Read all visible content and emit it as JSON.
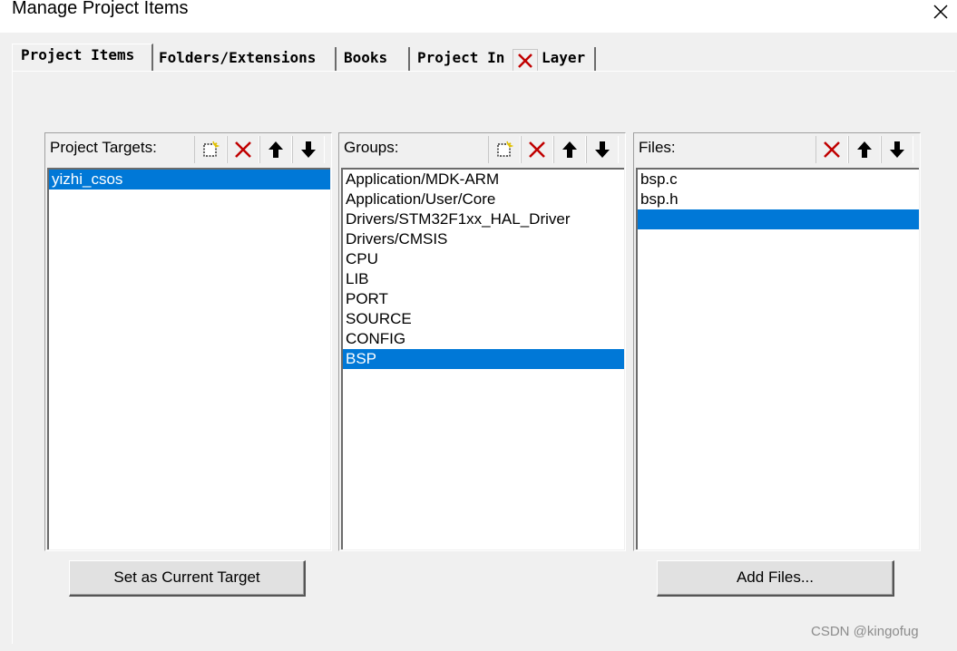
{
  "window": {
    "title": "Manage Project Items",
    "close_icon": "close-icon"
  },
  "tabs": [
    {
      "label": "Project Items",
      "active": true
    },
    {
      "label": "Folders/Extensions",
      "active": false
    },
    {
      "label": "Books",
      "active": false
    },
    {
      "label": "Project In",
      "active": false
    },
    {
      "label": "Layer",
      "active": false
    }
  ],
  "targets_panel": {
    "label": "Project Targets:",
    "tools": [
      "new-icon",
      "delete-icon",
      "move-up-icon",
      "move-down-icon"
    ],
    "items": [
      "yizhi_csos"
    ],
    "selected_index": 0
  },
  "groups_panel": {
    "label": "Groups:",
    "tools": [
      "new-icon",
      "delete-icon",
      "move-up-icon",
      "move-down-icon"
    ],
    "items": [
      "Application/MDK-ARM",
      "Application/User/Core",
      "Drivers/STM32F1xx_HAL_Driver",
      "Drivers/CMSIS",
      "CPU",
      "LIB",
      "PORT",
      "SOURCE",
      "CONFIG",
      "BSP"
    ],
    "selected_index": 9
  },
  "files_panel": {
    "label": "Files:",
    "tools": [
      "delete-icon",
      "move-up-icon",
      "move-down-icon"
    ],
    "items": [
      "bsp.c",
      "bsp.h",
      ""
    ],
    "selected_index": 2
  },
  "buttons": {
    "set_target": "Set as Current Target",
    "add_files": "Add Files..."
  },
  "watermark": "CSDN @kingofug",
  "colors": {
    "selection": "#0078d7",
    "delete_red": "#c00000",
    "dialog_bg": "#f0f0f0"
  }
}
